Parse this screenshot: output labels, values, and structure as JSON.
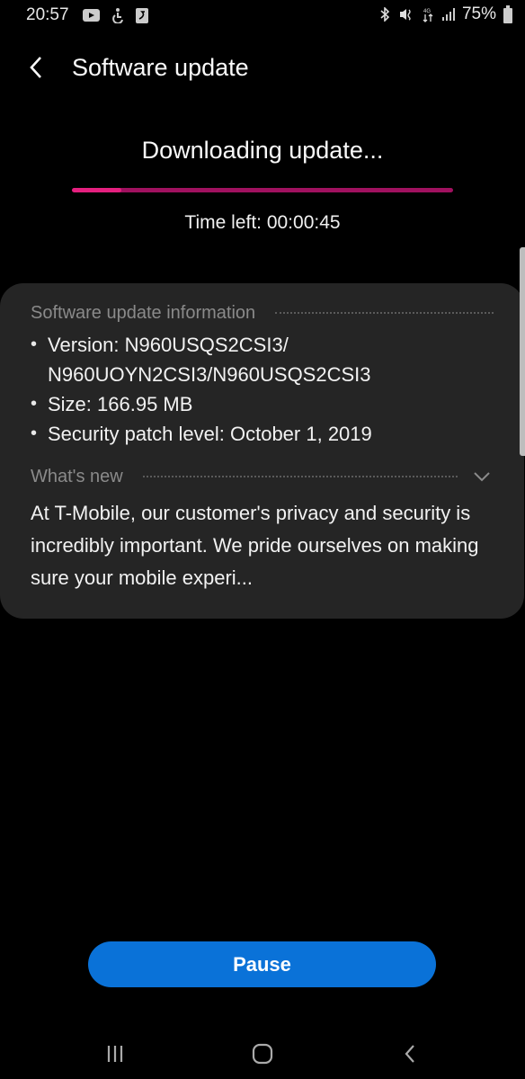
{
  "status_bar": {
    "time": "20:57",
    "left_icons": [
      "youtube-icon",
      "accessibility-icon",
      "app-notification-icon"
    ],
    "right_icons": [
      "bluetooth-icon",
      "vibrate-mute-icon",
      "data-transfer-icon",
      "signal-icon"
    ],
    "battery_percent": "75%"
  },
  "app_bar": {
    "back_icon": "chevron-left-icon",
    "title": "Software update"
  },
  "download": {
    "status": "Downloading update...",
    "progress_fraction": 0.13,
    "time_left": "Time left: 00:00:45",
    "colors": {
      "progress_fill": "#e5207f",
      "progress_track": "#a0115f"
    }
  },
  "info_card": {
    "section_title": "Software update information",
    "items": [
      {
        "text": "Version: N960USQS2CSI3/ N960UOYN2CSI3/N960USQS2CSI3"
      },
      {
        "text": "Size: 166.95 MB"
      },
      {
        "text": "Security patch level: October 1, 2019"
      }
    ],
    "whats_new": {
      "title": "What's new",
      "expand_icon": "chevron-down-icon",
      "text": "At T-Mobile, our customer's privacy and security is incredibly important. We pride ourselves on making sure your mobile experi..."
    }
  },
  "actions": {
    "pause_label": "Pause",
    "accent_color": "#0a72d8"
  },
  "nav_bar": {
    "buttons": [
      "recent-apps-icon",
      "home-icon",
      "back-icon"
    ]
  }
}
